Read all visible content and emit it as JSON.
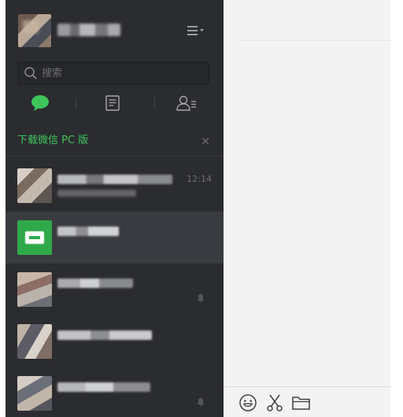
{
  "search": {
    "placeholder": "搜索"
  },
  "banner": {
    "text": "下载微信 PC 版",
    "close": "×"
  },
  "chats": [
    {
      "time": "12:14"
    },
    {
      "time": ""
    },
    {
      "time": ""
    },
    {
      "time": ""
    },
    {
      "time": ""
    }
  ],
  "colors": {
    "sidebar": "#2b2c30",
    "accent_green": "#3ec55a",
    "active_row": "#3a3b40",
    "main_bg": "#f3f3f3"
  },
  "icons": {
    "menu": "menu-icon",
    "search": "search-icon",
    "chats_tab": "chat-bubble-icon",
    "favorites_tab": "document-icon",
    "contacts_tab": "contacts-icon",
    "emoji": "emoji-icon",
    "screenshot": "scissors-icon",
    "file": "folder-icon",
    "mute": "mute-bell-icon"
  }
}
